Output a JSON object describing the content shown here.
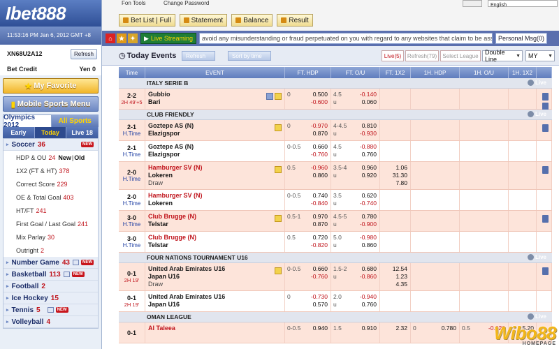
{
  "app": {
    "logo": "Ibet888",
    "clock": "11:53:16 PM Jan 6, 2012 GMT +8",
    "username": "XN68U2A12",
    "refresh_label": "Refresh",
    "credit_label": "Bet Credit",
    "credit_value": "Yen 0",
    "favorite_label": "My Favorite",
    "mobile_label": "Mobile Sports Menu"
  },
  "top": {
    "link1": "Fon Tools",
    "link2": "Change Password",
    "lang": "English",
    "tabs": [
      "Bet List | Full",
      "Statement",
      "Balance",
      "Result"
    ]
  },
  "announce": {
    "live_streaming": "Live Streaming",
    "marquee": "avoid any misunderstanding or fraud perpetuated on you with regard to any websites that claim to be asso",
    "personal_msg": "Personal Msg(0)"
  },
  "toolbar": {
    "title": "Today Events",
    "refresh": "Refresh",
    "sort": "Sort by time",
    "live": "Live(5)",
    "refresh2": "Refresh(79)",
    "select_league": "Select League",
    "line": "Double Line",
    "currency": "MY"
  },
  "sidebar": {
    "tab_olympics": "Olympics 2012",
    "tab_allsports": "All Sports",
    "periods": [
      "Early",
      "Today",
      "Live 18"
    ],
    "soccer": {
      "label": "Soccer",
      "count": "36",
      "new": "NEW"
    },
    "soccer_subs": [
      {
        "label": "1X2 (FT & HT)",
        "count": "378"
      },
      {
        "label": "Correct Score",
        "count": "229"
      },
      {
        "label": "OE & Total Goal",
        "count": "403"
      },
      {
        "label": "HT/FT",
        "count": "241"
      },
      {
        "label": "First Goal / Last Goal",
        "count": "241"
      },
      {
        "label": "Mix Parlay",
        "count": "30"
      },
      {
        "label": "Outright",
        "count": "2"
      }
    ],
    "hdp": {
      "label": "HDP & OU",
      "count": "24",
      "new": "New",
      "old": "Old"
    },
    "sports": [
      {
        "label": "Number Game",
        "count": "43",
        "new": "NEW"
      },
      {
        "label": "Basketball",
        "count": "113",
        "new": "NEW"
      },
      {
        "label": "Football",
        "count": "2",
        "new": ""
      },
      {
        "label": "Ice Hockey",
        "count": "15",
        "new": ""
      },
      {
        "label": "Tennis",
        "count": "5",
        "new": "NEW"
      },
      {
        "label": "Volleyball",
        "count": "4",
        "new": ""
      }
    ]
  },
  "columns": [
    "Time",
    "EVENT",
    "FT. HDP",
    "FT. O/U",
    "FT. 1X2",
    "1H. HDP",
    "1H. O/U",
    "1H. 1X2"
  ],
  "live_tag": "Live",
  "leagues": [
    {
      "name": "ITALY SERIE B",
      "matches": [
        {
          "score": "2-2",
          "time": "2H 49'+5",
          "home": "Gubbio",
          "away": "Bari",
          "draw": "",
          "hdp": "0",
          "hdp_h": "0.500",
          "hdp_a": "-0.600",
          "ou": "4.5",
          "ou_h": "-0.140",
          "ou_u": "u",
          "ou_a": "0.060",
          "x12": [
            "",
            "",
            ""
          ],
          "home_red": false
        }
      ]
    },
    {
      "name": "CLUB FRIENDLY",
      "matches": [
        {
          "score": "2-1",
          "time": "H.Time",
          "home": "Goztepe AS (N)",
          "away": "Elazigspor",
          "draw": "",
          "hdp": "0",
          "hdp_h": "-0.970",
          "hdp_a": "0.870",
          "ou": "4-4.5",
          "ou_h": "0.810",
          "ou_u": "u",
          "ou_a": "-0.930",
          "x12": [
            "",
            "",
            ""
          ],
          "home_red": false
        },
        {
          "score": "2-1",
          "time": "H.Time",
          "home": "Goztepe AS (N)",
          "away": "Elazigspor",
          "draw": "",
          "hdp": "0-0.5",
          "hdp_h": "0.660",
          "hdp_a": "-0.760",
          "ou": "4.5",
          "ou_h": "-0.880",
          "ou_u": "u",
          "ou_a": "0.760",
          "x12": [
            "",
            "",
            ""
          ],
          "home_red": false
        },
        {
          "score": "2-0",
          "time": "H.Time",
          "home": "Hamburger SV (N)",
          "away": "Lokeren",
          "draw": "Draw",
          "hdp": "0.5",
          "hdp_h": "-0.960",
          "hdp_a": "0.860",
          "ou": "3.5-4",
          "ou_h": "0.960",
          "ou_u": "u",
          "ou_a": "0.920",
          "x12": [
            "1.06",
            "31.30",
            "7.80"
          ],
          "home_red": true
        },
        {
          "score": "2-0",
          "time": "H.Time",
          "home": "Hamburger SV (N)",
          "away": "Lokeren",
          "draw": "",
          "hdp": "0-0.5",
          "hdp_h": "0.740",
          "hdp_a": "-0.840",
          "ou": "3.5",
          "ou_h": "0.620",
          "ou_u": "u",
          "ou_a": "-0.740",
          "x12": [
            "",
            "",
            ""
          ],
          "home_red": true
        },
        {
          "score": "3-0",
          "time": "H.Time",
          "home": "Club Brugge (N)",
          "away": "Telstar",
          "draw": "",
          "hdp": "0.5-1",
          "hdp_h": "0.970",
          "hdp_a": "0.870",
          "ou": "4.5-5",
          "ou_h": "0.780",
          "ou_u": "u",
          "ou_a": "-0.900",
          "x12": [
            "",
            "",
            ""
          ],
          "home_red": true
        },
        {
          "score": "3-0",
          "time": "H.Time",
          "home": "Club Brugge (N)",
          "away": "Telstar",
          "draw": "",
          "hdp": "0.5",
          "hdp_h": "0.720",
          "hdp_a": "-0.820",
          "ou": "5.0",
          "ou_h": "-0.980",
          "ou_u": "u",
          "ou_a": "0.860",
          "x12": [
            "",
            "",
            ""
          ],
          "home_red": true
        }
      ]
    },
    {
      "name": "FOUR NATIONS TOURNAMENT U16",
      "matches": [
        {
          "score": "0-1",
          "time": "2H 19'",
          "home": "United Arab Emirates U16",
          "away": "Japan U16",
          "draw": "Draw",
          "hdp": "0-0.5",
          "hdp_h": "0.660",
          "hdp_a": "-0.760",
          "ou": "1.5-2",
          "ou_h": "0.680",
          "ou_u": "u",
          "ou_a": "-0.860",
          "x12": [
            "12.54",
            "1.23",
            "4.35"
          ],
          "home_red": false
        },
        {
          "score": "0-1",
          "time": "2H 19'",
          "home": "United Arab Emirates U16",
          "away": "Japan U16",
          "draw": "",
          "hdp": "0",
          "hdp_h": "-0.730",
          "hdp_a": "0.570",
          "ou": "2.0",
          "ou_h": "-0.940",
          "ou_u": "u",
          "ou_a": "0.760",
          "x12": [
            "",
            "",
            ""
          ],
          "home_red": false
        }
      ]
    },
    {
      "name": "OMAN LEAGUE",
      "matches": [
        {
          "score": "0-1",
          "time": "",
          "home": "Al Taleea",
          "away": "",
          "draw": "",
          "hdp": "0-0.5",
          "hdp_h": "0.940",
          "hdp_a": "",
          "ou": "1.5",
          "ou_h": "0.910",
          "ou_u": "",
          "ou_a": "",
          "x12": [
            "2.32",
            "",
            ""
          ],
          "h1hdp": "0",
          "h1hdp_h": "0.780",
          "h1ou": "0.5",
          "h1ou_h": "-0.620",
          "h112": "5.20",
          "home_red": true
        }
      ]
    }
  ],
  "watermark": "Wibo88",
  "watermark_sub": "HOMEPAGE"
}
